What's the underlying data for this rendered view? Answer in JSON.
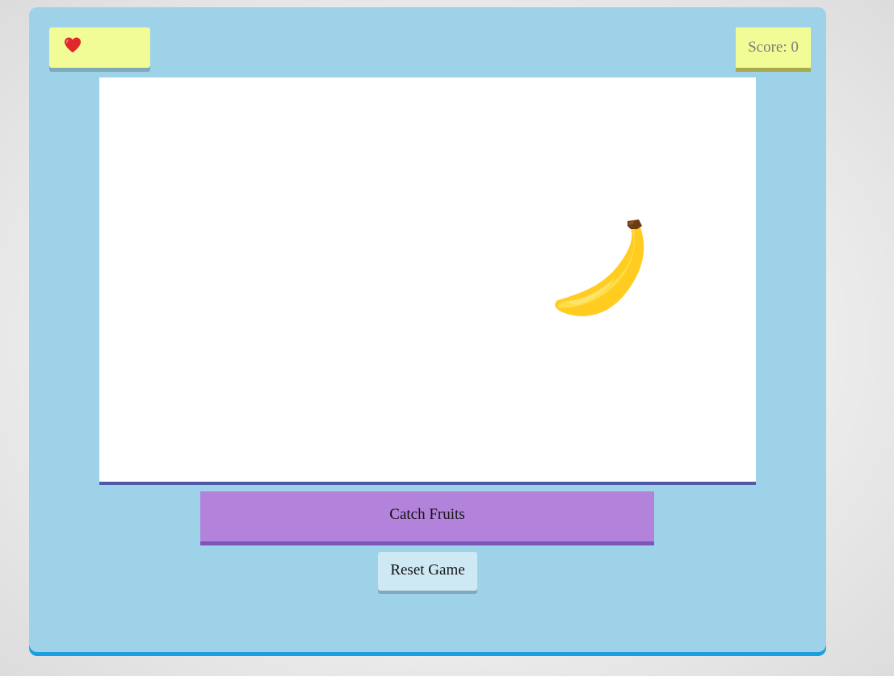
{
  "hud": {
    "lives_icon": "heart-icon",
    "lives_count": 1,
    "score_label": "Score: 0"
  },
  "play_area": {
    "falling_fruit": "banana-icon"
  },
  "controls": {
    "catch_label": "Catch Fruits",
    "reset_label": "Reset Game"
  },
  "colors": {
    "frame": "#9ed2e9",
    "frame_edge": "#1a9fe0",
    "panel": "#f1fc96",
    "catch_button": "#b382db",
    "reset_button": "#cfe9f4",
    "heart": "#e0282a",
    "banana": "#ffd633"
  }
}
